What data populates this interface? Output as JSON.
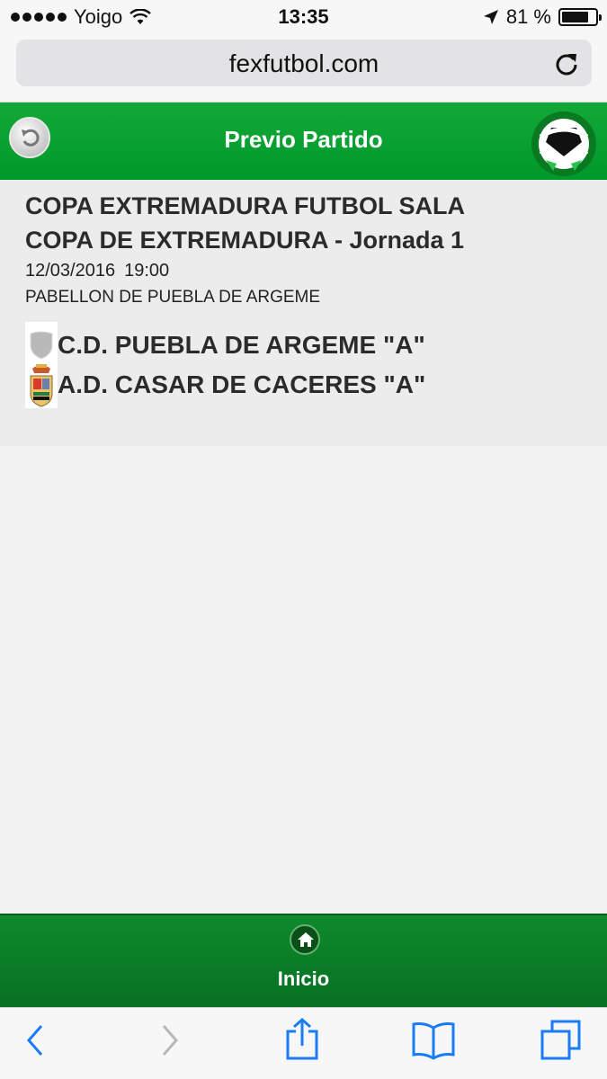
{
  "status_bar": {
    "carrier": "Yoigo",
    "time": "13:35",
    "battery": "81 %",
    "battery_level": 0.81
  },
  "browser": {
    "url": "fexfutbol.com"
  },
  "header": {
    "title": "Previo Partido"
  },
  "match": {
    "competition": "COPA EXTREMADURA FUTBOL SALA",
    "round": "COPA DE EXTREMADURA - Jornada 1",
    "date": "12/03/2016",
    "time": "19:00",
    "venue": "PABELLON DE PUEBLA DE ARGEME",
    "home_team": "C.D. PUEBLA DE ARGEME \"A\"",
    "away_team": "A.D. CASAR DE CACERES \"A\""
  },
  "footer": {
    "label": "Inicio"
  },
  "colors": {
    "header_green": "#12a838",
    "footer_green": "#0f8a2c",
    "ios_blue": "#1a7cf5"
  }
}
